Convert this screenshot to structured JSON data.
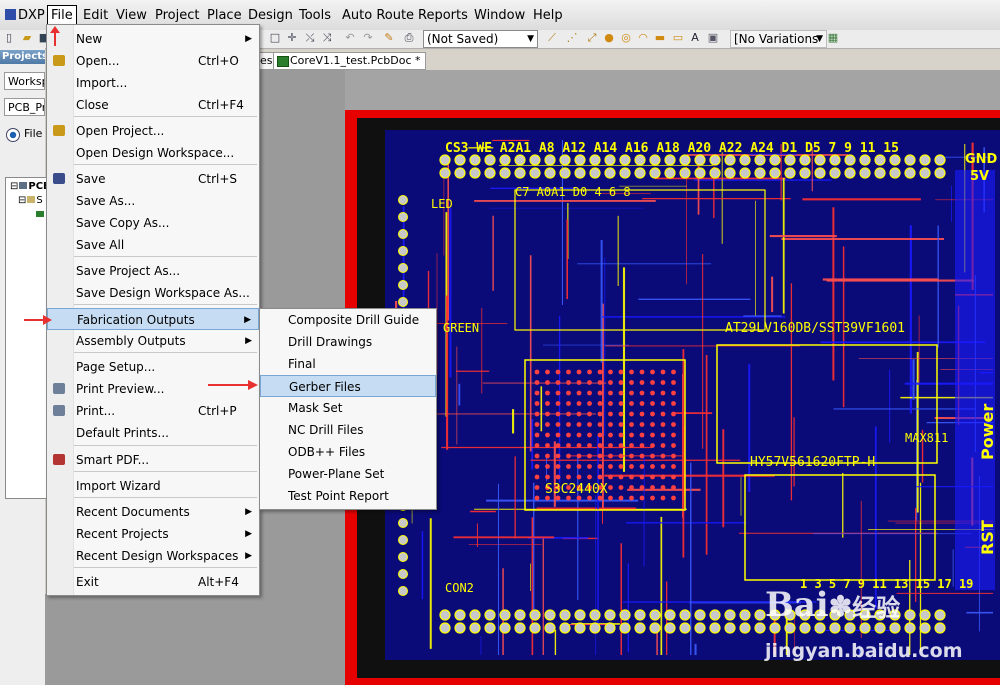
{
  "menubar": {
    "app": "DXP",
    "items": [
      "File",
      "Edit",
      "View",
      "Project",
      "Place",
      "Design",
      "Tools",
      "Auto Route",
      "Reports",
      "Window",
      "Help"
    ]
  },
  "toolbar": {
    "status_combo": "(Not Saved)",
    "variations_combo": "[No Variations"
  },
  "tabs": {
    "partial": "es",
    "active": "CoreV1.1_test.PcbDoc *"
  },
  "panel": {
    "title": "Projects",
    "workspace_field": "Worksp",
    "project_field": "PCB_Pr",
    "radio_label": "File",
    "tree_root": "PCB",
    "tree_child": "S"
  },
  "file_menu": [
    {
      "label": "New",
      "shortcut": "",
      "submenu": true
    },
    {
      "label": "Open...",
      "shortcut": "Ctrl+O",
      "submenu": false
    },
    {
      "label": "Import...",
      "shortcut": "",
      "submenu": false
    },
    {
      "label": "Close",
      "shortcut": "Ctrl+F4",
      "submenu": false
    },
    {
      "label": "Open Project...",
      "shortcut": "",
      "submenu": false
    },
    {
      "label": "Open Design Workspace...",
      "shortcut": "",
      "submenu": false
    },
    {
      "label": "Save",
      "shortcut": "Ctrl+S",
      "submenu": false
    },
    {
      "label": "Save As...",
      "shortcut": "",
      "submenu": false
    },
    {
      "label": "Save Copy As...",
      "shortcut": "",
      "submenu": false
    },
    {
      "label": "Save All",
      "shortcut": "",
      "submenu": false
    },
    {
      "label": "Save Project As...",
      "shortcut": "",
      "submenu": false
    },
    {
      "label": "Save Design Workspace As...",
      "shortcut": "",
      "submenu": false
    },
    {
      "label": "Fabrication Outputs",
      "shortcut": "",
      "submenu": true
    },
    {
      "label": "Assembly Outputs",
      "shortcut": "",
      "submenu": true
    },
    {
      "label": "Page Setup...",
      "shortcut": "",
      "submenu": false
    },
    {
      "label": "Print Preview...",
      "shortcut": "",
      "submenu": false
    },
    {
      "label": "Print...",
      "shortcut": "Ctrl+P",
      "submenu": false
    },
    {
      "label": "Default Prints...",
      "shortcut": "",
      "submenu": false
    },
    {
      "label": "Smart PDF...",
      "shortcut": "",
      "submenu": false
    },
    {
      "label": "Import Wizard",
      "shortcut": "",
      "submenu": false
    },
    {
      "label": "Recent Documents",
      "shortcut": "",
      "submenu": true
    },
    {
      "label": "Recent Projects",
      "shortcut": "",
      "submenu": true
    },
    {
      "label": "Recent Design Workspaces",
      "shortcut": "",
      "submenu": true
    },
    {
      "label": "Exit",
      "shortcut": "Alt+F4",
      "submenu": false
    }
  ],
  "fabrication_menu": [
    "Composite Drill Guide",
    "Drill Drawings",
    "Final",
    "Gerber Files",
    "Mask Set",
    "NC Drill Files",
    "ODB++ Files",
    "Power-Plane Set",
    "Test Point Report"
  ],
  "pcb_labels": {
    "top_row": "CS3  WE       A2A1    A8    A12 A14 A16 A18 A20 A22 A24  D1   D5 7 9 11   15",
    "row2": "C7  A0A1            D0  4 6 8",
    "gnd": "GND",
    "v5": "5V",
    "power": "Power",
    "rst": "RST",
    "chip1": "AT29LV160DB/SST39VF1601",
    "chip2": "HY57V561620FTP-H",
    "chip3": "S3C2440X",
    "chip4": "MAX811",
    "con": "CON2",
    "green": "GREEN",
    "led": "LED",
    "bot_nums": "1 3 5 7 9 11 13 15 17 19"
  },
  "watermark": {
    "brand": "Bai",
    "brand_suffix": "经验",
    "site": "jingyan.baidu.com"
  },
  "colors": {
    "board": "#e60000",
    "copper": "#1a1aff",
    "silk": "#ffff00",
    "highlight": "#c6dcf2"
  }
}
